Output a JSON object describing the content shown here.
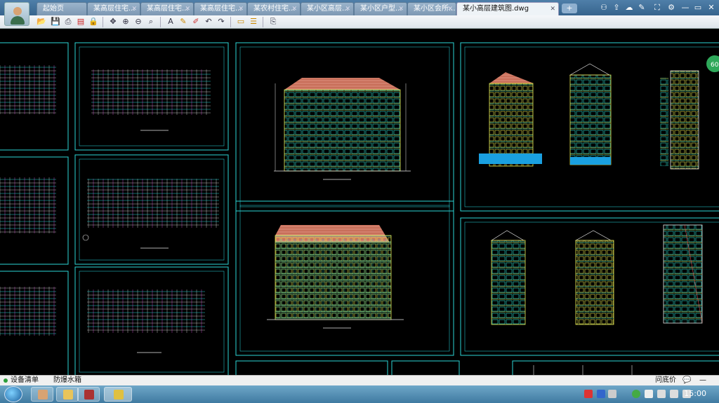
{
  "tabs": [
    {
      "label": "起始页",
      "active": false
    },
    {
      "label": "某高层住宅...",
      "active": false
    },
    {
      "label": "某高层住宅...",
      "active": false
    },
    {
      "label": "某高层住宅...",
      "active": false
    },
    {
      "label": "某农村住宅...",
      "active": false
    },
    {
      "label": "某小区高层...",
      "active": false
    },
    {
      "label": "某小区户型...",
      "active": false
    },
    {
      "label": "某小区会所...",
      "active": false
    },
    {
      "label": "某小高层建筑图.dwg",
      "active": true
    }
  ],
  "new_tab_label": "+",
  "window_controls": {
    "minimize": "—",
    "restore": "▭",
    "close": "✕"
  },
  "status": {
    "device_list": "设备清单",
    "blast_water": "防爆水箱",
    "ask_label": "问底价"
  },
  "clock": "15:00",
  "badge": "60",
  "colors": {
    "tab_bar": "#4f7fa9",
    "frame": "#2dd6d6",
    "taskbar": "#3f7aa1",
    "canvas": "#000000"
  },
  "icons": {
    "toolbar": [
      "open-icon",
      "save-icon",
      "print-icon",
      "pdf-icon",
      "lock-icon",
      "pan-icon",
      "zoom-in-icon",
      "zoom-out-icon",
      "zoom-window-icon",
      "text-icon",
      "pencil-icon",
      "cloud-icon",
      "undo-icon",
      "redo-icon",
      "measure-icon",
      "layers-icon",
      "export-icon"
    ]
  }
}
